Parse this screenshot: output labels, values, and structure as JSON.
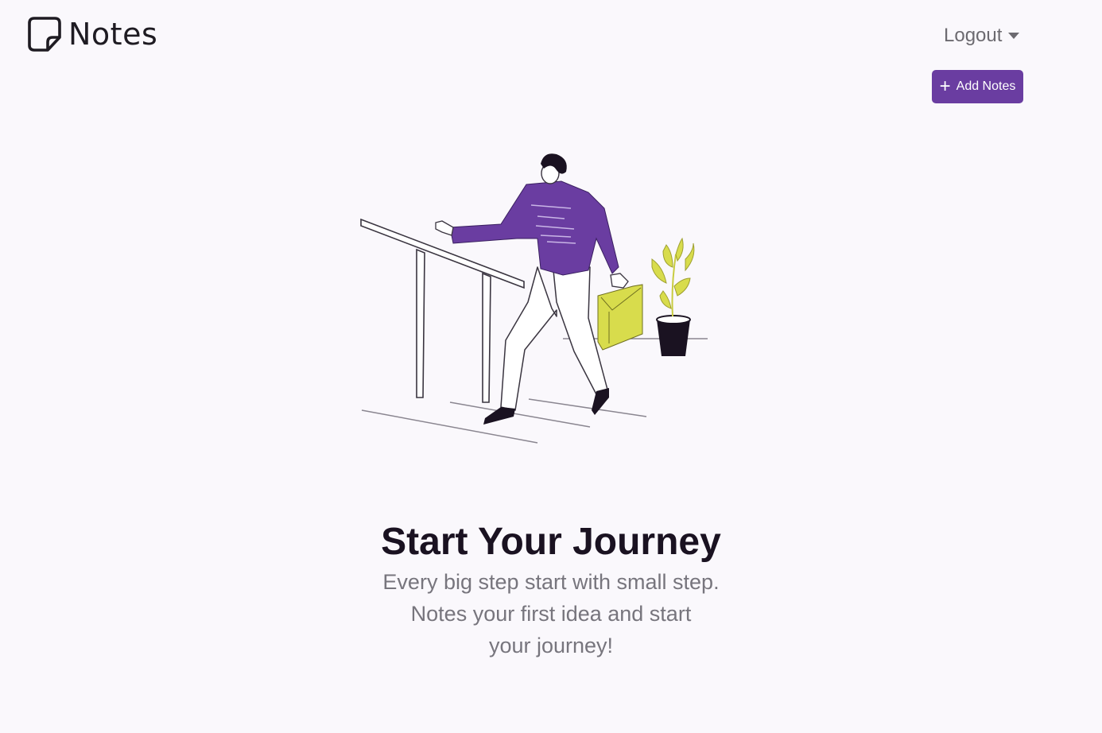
{
  "navbar": {
    "brand_name": "Notes",
    "brand_icon": "sticky-note-icon",
    "logout_label": "Logout",
    "logout_icon": "caret-down-icon"
  },
  "toolbar": {
    "add_label": "Add Notes",
    "add_icon": "plus-icon"
  },
  "empty_state": {
    "title": "Start Your Journey",
    "subtitle_lines": [
      "Every big step start with small step.",
      "Notes your first idea and start",
      "your journey!"
    ],
    "illustration": "person-walking-stairs-illustration"
  },
  "colors": {
    "accent": "#6a3da1",
    "background": "#faf8fc",
    "briefcase": "#d8dc4c",
    "plant": "#d8dc4c",
    "text_dark": "#1a1221",
    "text_muted": "#77757d"
  }
}
